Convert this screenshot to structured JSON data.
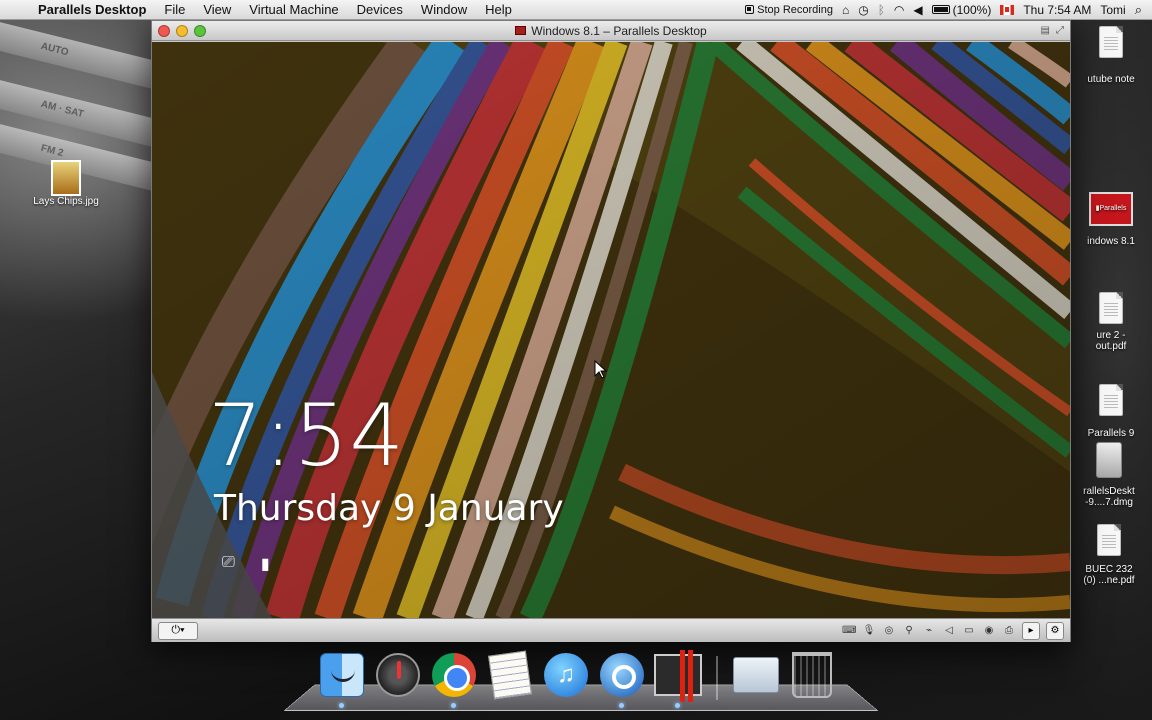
{
  "menubar": {
    "app_name": "Parallels Desktop",
    "items": [
      "File",
      "View",
      "Virtual Machine",
      "Devices",
      "Window",
      "Help"
    ],
    "stop_recording": "Stop Recording",
    "battery": "(100%)",
    "clock": "Thu 7:54 AM",
    "user": "Tomi"
  },
  "desktop_icons": {
    "lays_chips": "Lays Chips.jpg",
    "youtube_note": "utube note",
    "windows81": "indows 8.1",
    "figure_pdf_1": "ure 2 -",
    "figure_pdf_2": "out.pdf",
    "parallels9": "Parallels 9",
    "dmg_1": "rallelsDeskt",
    "dmg_2": "-9....7.dmg",
    "buec_1": "BUEC 232",
    "buec_2": "(0) ...ne.pdf"
  },
  "window": {
    "title": "Windows 8.1 – Parallels Desktop"
  },
  "lockscreen": {
    "time": "7:54",
    "date": "Thursday 9 January",
    "network_icon": "network-icon",
    "battery_icon": "battery-icon"
  },
  "toolbar": {
    "power_label": "⏻▾"
  },
  "dashboard_strip": {
    "line1": "AUTO",
    "line2": "AM · SAT",
    "line3": "FM 2"
  }
}
